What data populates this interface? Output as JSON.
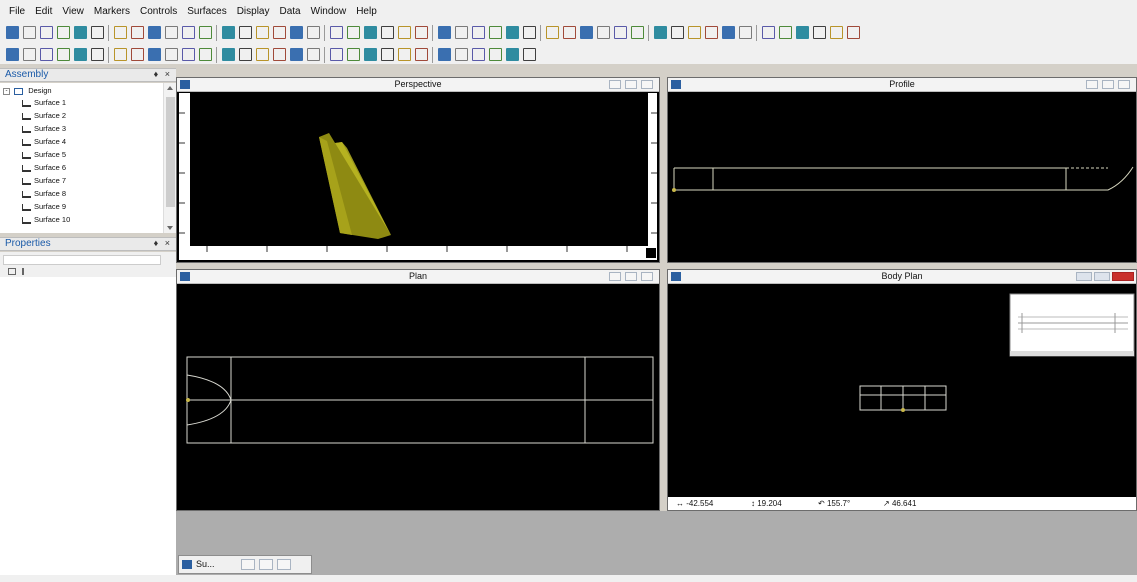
{
  "menu": [
    "File",
    "Edit",
    "View",
    "Markers",
    "Controls",
    "Surfaces",
    "Display",
    "Data",
    "Window",
    "Help"
  ],
  "panels": {
    "assembly_title": "Assembly",
    "properties_title": "Properties",
    "panel_controls": "♦ ×"
  },
  "tree": {
    "root": "Design",
    "items": [
      "Surface 1",
      "Surface 2",
      "Surface 3",
      "Surface 4",
      "Surface 5",
      "Surface 6",
      "Surface 7",
      "Surface 8",
      "Surface 9",
      "Surface 10"
    ]
  },
  "viewports": {
    "perspective": "Perspective",
    "profile": "Profile",
    "plan": "Plan",
    "body_plan": "Body Plan"
  },
  "body_plan_status": {
    "width": "-42.554",
    "height": "19.204",
    "angle": "155.7°",
    "diag": "46.641"
  },
  "taskbar": {
    "tab_label": "Su..."
  },
  "colors": {
    "accent": "#1a5aa8",
    "surface": "#b5b01a",
    "close_red": "#c9302c"
  },
  "icons": [
    "window-icon",
    "restore-icon",
    "maximize-icon",
    "close-icon",
    "chevron-up-icon",
    "chevron-down-icon",
    "sort-icon",
    "category-icon"
  ]
}
